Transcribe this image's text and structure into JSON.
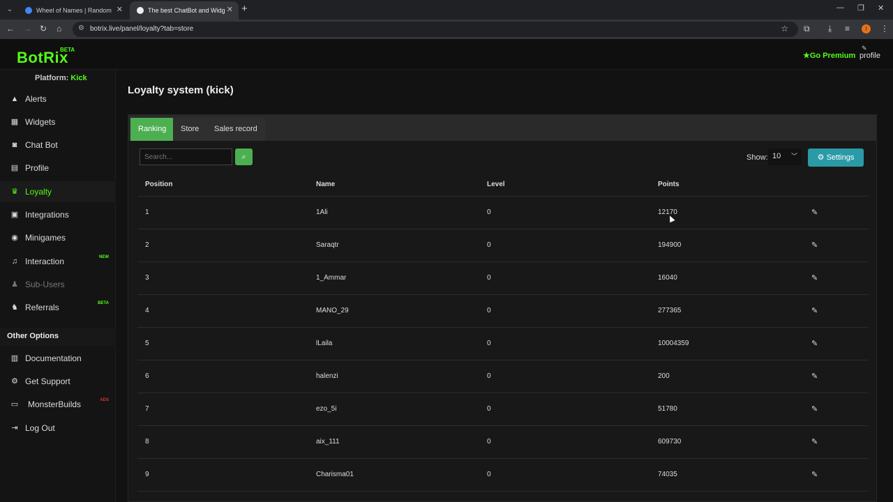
{
  "browser": {
    "tabs": [
      {
        "title": "Wheel of Names | Random nam",
        "favicon_color": "#4285f4"
      },
      {
        "title": "The best ChatBot and Widgets",
        "favicon_color": "#eeeeee"
      }
    ],
    "url": "botrix.live/panel/loyalty?tab=store",
    "profile_initial": "I"
  },
  "header": {
    "logo": "BotRix",
    "logo_badge": "BETA",
    "go_premium": "Go Premium",
    "profile_label": "profile"
  },
  "sidebar": {
    "platform_label": "Platform:",
    "platform_value": "Kick",
    "items": [
      {
        "label": "Alerts",
        "icon": "warning-icon"
      },
      {
        "label": "Widgets",
        "icon": "grid-icon"
      },
      {
        "label": "Chat Bot",
        "icon": "robot-icon"
      },
      {
        "label": "Profile",
        "icon": "id-card-icon"
      },
      {
        "label": "Loyalty",
        "icon": "trophy-icon",
        "active": true
      },
      {
        "label": "Integrations",
        "icon": "puzzle-icon"
      },
      {
        "label": "Minigames",
        "icon": "gamepad-icon"
      },
      {
        "label": "Interaction",
        "icon": "music-icon",
        "badge": "NEW"
      },
      {
        "label": "Sub-Users",
        "icon": "users-icon",
        "disabled": true
      },
      {
        "label": "Referrals",
        "icon": "user-group-icon",
        "badge": "BETA"
      }
    ],
    "other_options_title": "Other Options",
    "other_items": [
      {
        "label": "Documentation",
        "icon": "scroll-icon"
      },
      {
        "label": "Get Support",
        "icon": "gear-icon"
      },
      {
        "label": "MonsterBuilds",
        "icon": "laptop-icon",
        "badge": "ADS"
      },
      {
        "label": "Log Out",
        "icon": "logout-icon"
      }
    ]
  },
  "main": {
    "title": "Loyalty system (kick)",
    "tabs": [
      "Ranking",
      "Store",
      "Sales record"
    ],
    "active_tab": "Ranking",
    "search_placeholder": "Search...",
    "show_label": "Show:",
    "show_value": "10",
    "settings_label": "Settings",
    "table": {
      "columns": [
        "Position",
        "Name",
        "Level",
        "Points"
      ],
      "rows": [
        [
          "1",
          "1Ali",
          "0",
          "12170"
        ],
        [
          "2",
          "Saraqtr",
          "0",
          "194900"
        ],
        [
          "3",
          "1_Ammar",
          "0",
          "16040"
        ],
        [
          "4",
          "MANO_29",
          "0",
          "277365"
        ],
        [
          "5",
          "lLaila",
          "0",
          "10004359"
        ],
        [
          "6",
          "halenzi",
          "0",
          "200"
        ],
        [
          "7",
          "ezo_5i",
          "0",
          "51780"
        ],
        [
          "8",
          "aix_111",
          "0",
          "609730"
        ],
        [
          "9",
          "Charisma01",
          "0",
          "74035"
        ]
      ]
    }
  },
  "colors": {
    "accent": "#53fc18",
    "tab_active": "#4caf50",
    "settings": "#2a9aa6"
  }
}
